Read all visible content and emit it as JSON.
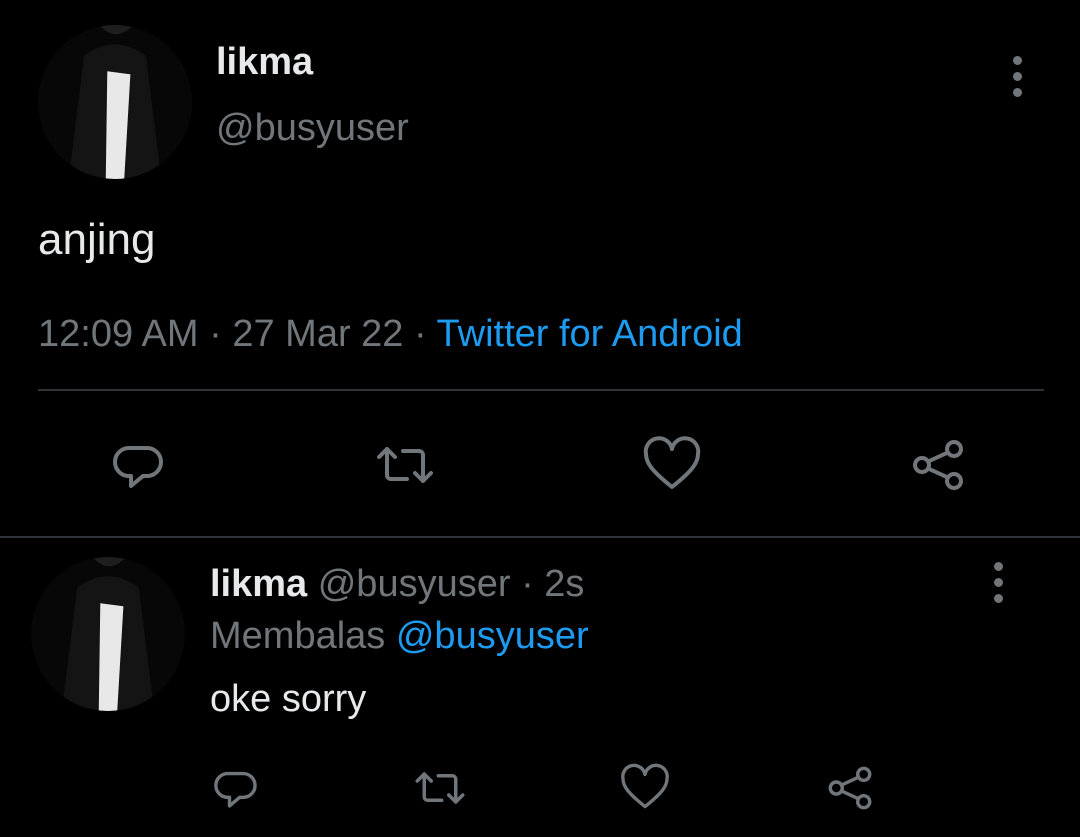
{
  "main_tweet": {
    "display_name": "likma",
    "handle": "@busyuser",
    "text": "anjing",
    "time": "12:09 AM",
    "separator": "·",
    "date": "27 Mar 22",
    "source": "Twitter for Android",
    "actions": {
      "reply_icon": "reply-icon",
      "retweet_icon": "retweet-icon",
      "like_icon": "heart-icon",
      "share_icon": "share-icon"
    }
  },
  "reply": {
    "display_name": "likma",
    "handle": "@busyuser",
    "separator": "·",
    "age": "2s",
    "replying_prefix": "Membalas",
    "replying_to": "@busyuser",
    "text": "oke sorry"
  },
  "colors": {
    "background": "#000000",
    "text": "#e7e9ea",
    "muted": "#71767b",
    "accent": "#1d9bf0",
    "divider": "#2f3336"
  }
}
